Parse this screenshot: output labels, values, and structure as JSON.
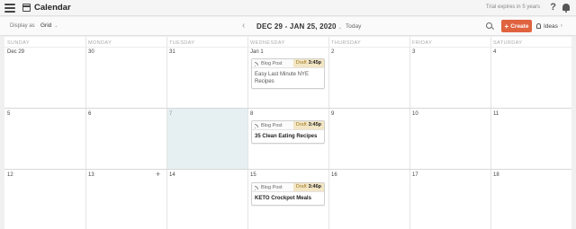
{
  "header": {
    "title": "Calendar",
    "trial_text": "Trial expires in 5 years",
    "help_label": "?"
  },
  "toolbar": {
    "display_as_label": "Display as",
    "view_value": "Grid",
    "prev_label": "‹",
    "date_range": "DEC 29 - JAN 25, 2020",
    "next_label": "›",
    "today_label": "Today",
    "create_label": "Create",
    "ideas_label": "Ideas",
    "accent_color": "#e0633f"
  },
  "calendar": {
    "weekdays": [
      "SUNDAY",
      "MONDAY",
      "TUESDAY",
      "WEDNESDAY",
      "THURSDAY",
      "FRIDAY",
      "SATURDAY"
    ],
    "weeks": [
      [
        "Dec 29",
        "30",
        "31",
        "Jan 1",
        "2",
        "3",
        "4"
      ],
      [
        "5",
        "6",
        "7",
        "8",
        "9",
        "10",
        "11"
      ],
      [
        "12",
        "13",
        "14",
        "15",
        "16",
        "17",
        "18"
      ]
    ],
    "today": "7",
    "add_icon_label": "+",
    "events": [
      {
        "type": "Blog Post",
        "status": "Draft",
        "time": "3:45p",
        "title": "Easy Last Minute NYE Recipes"
      },
      {
        "type": "Blog Post",
        "status": "Draft",
        "time": "3:45p",
        "title": "35 Clean Eating Recipes"
      },
      {
        "type": "Blog Post",
        "status": "Draft",
        "time": "3:46p",
        "title": "KETO Crockpot Meals"
      }
    ]
  }
}
